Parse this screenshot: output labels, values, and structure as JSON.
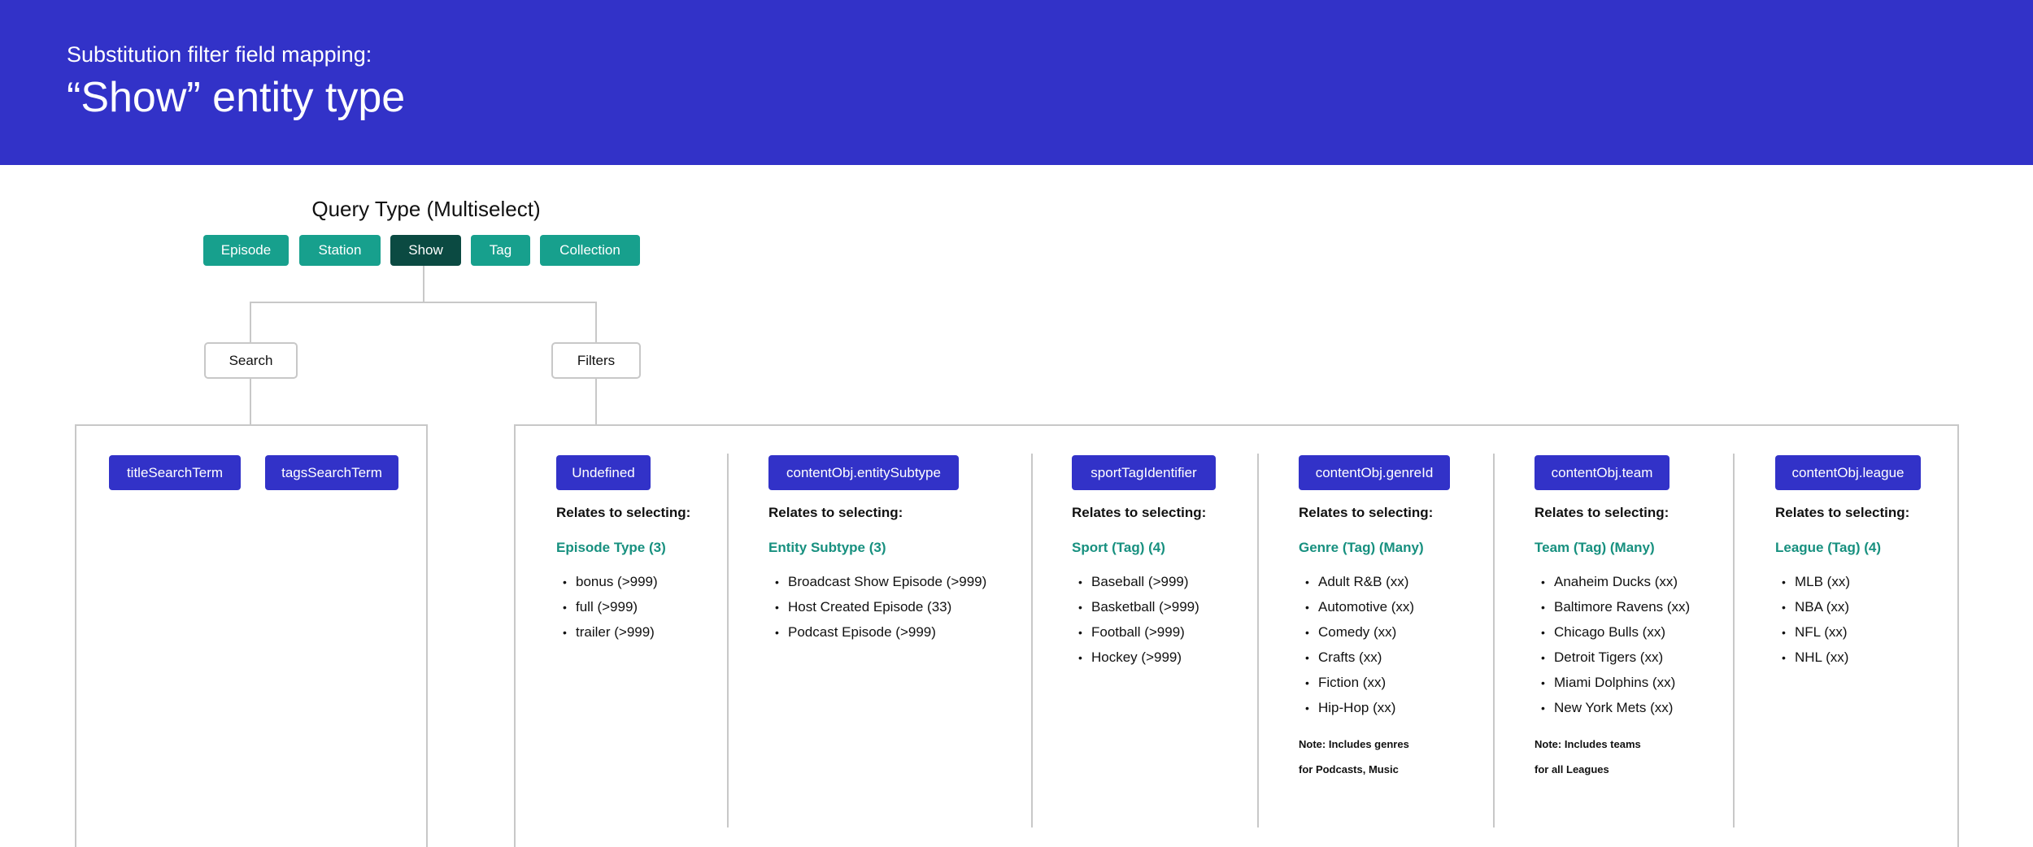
{
  "header": {
    "subtitle": "Substitution filter field mapping:",
    "title": "“Show” entity type"
  },
  "query_type": {
    "title": "Query Type (Multiselect)",
    "options": [
      {
        "label": "Episode",
        "selected": false
      },
      {
        "label": "Station",
        "selected": false
      },
      {
        "label": "Show",
        "selected": true
      },
      {
        "label": "Tag",
        "selected": false
      },
      {
        "label": "Collection",
        "selected": false
      }
    ]
  },
  "nodes": {
    "search": "Search",
    "filters": "Filters"
  },
  "search_terms": [
    "titleSearchTerm",
    "tagsSearchTerm"
  ],
  "filters": [
    {
      "field": "Undefined",
      "relates": "Relates to selecting:",
      "tag_type": "Episode Type (3)",
      "items": [
        "bonus (>999)",
        "full (>999)",
        "trailer (>999)"
      ]
    },
    {
      "field": "contentObj.entitySubtype",
      "relates": "Relates to selecting:",
      "tag_type": "Entity Subtype (3)",
      "items": [
        "Broadcast Show Episode (>999)",
        "Host Created Episode (33)",
        "Podcast Episode (>999)"
      ]
    },
    {
      "field": "sportTagIdentifier",
      "relates": "Relates to selecting:",
      "tag_type": "Sport (Tag) (4)",
      "items": [
        "Baseball (>999)",
        "Basketball (>999)",
        "Football (>999)",
        "Hockey (>999)"
      ]
    },
    {
      "field": "contentObj.genreId",
      "relates": "Relates to selecting:",
      "tag_type": "Genre (Tag) (Many)",
      "items": [
        "Adult R&B (xx)",
        "Automotive (xx)",
        "Comedy (xx)",
        "Crafts (xx)",
        "Fiction (xx)",
        "Hip-Hop (xx)"
      ],
      "note": [
        "Note: Includes genres",
        "for Podcasts, Music"
      ]
    },
    {
      "field": "contentObj.team",
      "relates": "Relates to selecting:",
      "tag_type": "Team (Tag) (Many)",
      "items": [
        "Anaheim Ducks (xx)",
        "Baltimore Ravens (xx)",
        "Chicago Bulls (xx)",
        "Detroit Tigers (xx)",
        "Miami Dolphins (xx)",
        "New York Mets (xx)"
      ],
      "note": [
        "Note: Includes teams",
        "for all Leagues"
      ]
    },
    {
      "field": "contentObj.league",
      "relates": "Relates to selecting:",
      "tag_type": "League (Tag) (4)",
      "items": [
        "MLB (xx)",
        "NBA (xx)",
        "NFL (xx)",
        "NHL (xx)"
      ]
    }
  ],
  "colors": {
    "header_bg": "#3232c8",
    "field_pill": "#3232c8",
    "query_option": "#17a08d",
    "query_option_selected": "#0b4a42",
    "tag_type_text": "#17907f",
    "connector": "#c8c8c8"
  }
}
